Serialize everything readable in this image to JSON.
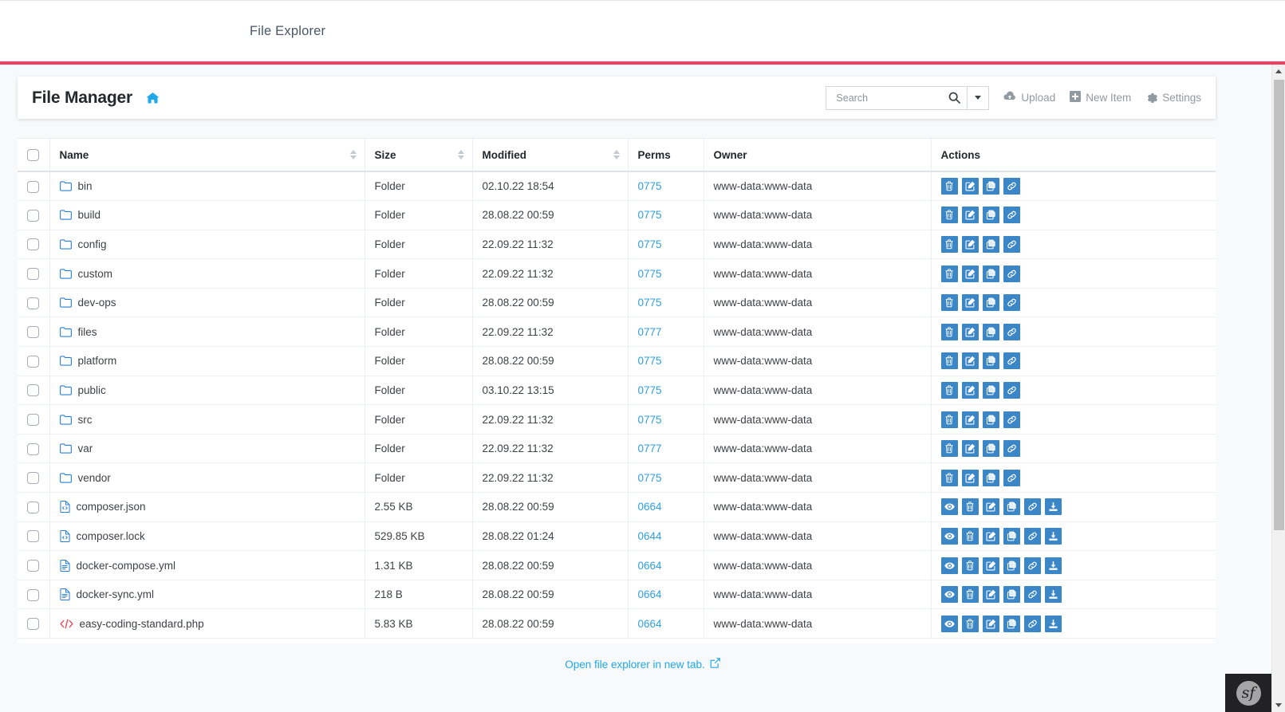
{
  "topbar": {
    "title": "File Explorer"
  },
  "card": {
    "title": "File Manager",
    "home_icon": "home-icon"
  },
  "search": {
    "placeholder": "Search",
    "value": "",
    "icon": "search-icon",
    "caret_icon": "chevron-down-icon"
  },
  "toolbar": {
    "upload_label": "Upload",
    "upload_icon": "cloud-upload-icon",
    "new_item_label": "New Item",
    "new_item_icon": "plus-square-icon",
    "settings_label": "Settings",
    "settings_icon": "gear-icon"
  },
  "table": {
    "columns": [
      {
        "label": "",
        "sortable": false
      },
      {
        "label": "Name",
        "sortable": true
      },
      {
        "label": "Size",
        "sortable": true
      },
      {
        "label": "Modified",
        "sortable": true
      },
      {
        "label": "Perms",
        "sortable": false
      },
      {
        "label": "Owner",
        "sortable": false
      },
      {
        "label": "Actions",
        "sortable": false
      }
    ],
    "rows": [
      {
        "name": "bin",
        "kind": "folder",
        "icon": "folder-icon",
        "size": "Folder",
        "modified": "02.10.22 18:54",
        "perms": "0775",
        "owner": "www-data:www-data",
        "actions": [
          "delete-icon",
          "edit-icon",
          "copy-icon",
          "link-icon"
        ]
      },
      {
        "name": "build",
        "kind": "folder",
        "icon": "folder-icon",
        "size": "Folder",
        "modified": "28.08.22 00:59",
        "perms": "0775",
        "owner": "www-data:www-data",
        "actions": [
          "delete-icon",
          "edit-icon",
          "copy-icon",
          "link-icon"
        ]
      },
      {
        "name": "config",
        "kind": "folder",
        "icon": "folder-icon",
        "size": "Folder",
        "modified": "22.09.22 11:32",
        "perms": "0775",
        "owner": "www-data:www-data",
        "actions": [
          "delete-icon",
          "edit-icon",
          "copy-icon",
          "link-icon"
        ]
      },
      {
        "name": "custom",
        "kind": "folder",
        "icon": "folder-icon",
        "size": "Folder",
        "modified": "22.09.22 11:32",
        "perms": "0775",
        "owner": "www-data:www-data",
        "actions": [
          "delete-icon",
          "edit-icon",
          "copy-icon",
          "link-icon"
        ]
      },
      {
        "name": "dev-ops",
        "kind": "folder",
        "icon": "folder-icon",
        "size": "Folder",
        "modified": "28.08.22 00:59",
        "perms": "0775",
        "owner": "www-data:www-data",
        "actions": [
          "delete-icon",
          "edit-icon",
          "copy-icon",
          "link-icon"
        ]
      },
      {
        "name": "files",
        "kind": "folder",
        "icon": "folder-icon",
        "size": "Folder",
        "modified": "22.09.22 11:32",
        "perms": "0777",
        "owner": "www-data:www-data",
        "actions": [
          "delete-icon",
          "edit-icon",
          "copy-icon",
          "link-icon"
        ]
      },
      {
        "name": "platform",
        "kind": "folder",
        "icon": "folder-icon",
        "size": "Folder",
        "modified": "28.08.22 00:59",
        "perms": "0775",
        "owner": "www-data:www-data",
        "actions": [
          "delete-icon",
          "edit-icon",
          "copy-icon",
          "link-icon"
        ]
      },
      {
        "name": "public",
        "kind": "folder",
        "icon": "folder-icon",
        "size": "Folder",
        "modified": "03.10.22 13:15",
        "perms": "0775",
        "owner": "www-data:www-data",
        "actions": [
          "delete-icon",
          "edit-icon",
          "copy-icon",
          "link-icon"
        ]
      },
      {
        "name": "src",
        "kind": "folder",
        "icon": "folder-icon",
        "size": "Folder",
        "modified": "22.09.22 11:32",
        "perms": "0775",
        "owner": "www-data:www-data",
        "actions": [
          "delete-icon",
          "edit-icon",
          "copy-icon",
          "link-icon"
        ]
      },
      {
        "name": "var",
        "kind": "folder",
        "icon": "folder-icon",
        "size": "Folder",
        "modified": "22.09.22 11:32",
        "perms": "0777",
        "owner": "www-data:www-data",
        "actions": [
          "delete-icon",
          "edit-icon",
          "copy-icon",
          "link-icon"
        ]
      },
      {
        "name": "vendor",
        "kind": "folder",
        "icon": "folder-icon",
        "size": "Folder",
        "modified": "22.09.22 11:32",
        "perms": "0775",
        "owner": "www-data:www-data",
        "actions": [
          "delete-icon",
          "edit-icon",
          "copy-icon",
          "link-icon"
        ]
      },
      {
        "name": "composer.json",
        "kind": "file-code-blue",
        "icon": "file-code-icon",
        "size": "2.55 KB",
        "modified": "28.08.22 00:59",
        "perms": "0664",
        "owner": "www-data:www-data",
        "actions": [
          "view-icon",
          "delete-icon",
          "edit-icon",
          "copy-icon",
          "link-icon",
          "download-icon"
        ]
      },
      {
        "name": "composer.lock",
        "kind": "file-code-blue",
        "icon": "file-code-icon",
        "size": "529.85 KB",
        "modified": "28.08.22 01:24",
        "perms": "0644",
        "owner": "www-data:www-data",
        "actions": [
          "view-icon",
          "delete-icon",
          "edit-icon",
          "copy-icon",
          "link-icon",
          "download-icon"
        ]
      },
      {
        "name": "docker-compose.yml",
        "kind": "file-text-blue",
        "icon": "file-text-icon",
        "size": "1.31 KB",
        "modified": "28.08.22 00:59",
        "perms": "0664",
        "owner": "www-data:www-data",
        "actions": [
          "view-icon",
          "delete-icon",
          "edit-icon",
          "copy-icon",
          "link-icon",
          "download-icon"
        ]
      },
      {
        "name": "docker-sync.yml",
        "kind": "file-text-blue",
        "icon": "file-text-icon",
        "size": "218 B",
        "modified": "28.08.22 00:59",
        "perms": "0664",
        "owner": "www-data:www-data",
        "actions": [
          "view-icon",
          "delete-icon",
          "edit-icon",
          "copy-icon",
          "link-icon",
          "download-icon"
        ]
      },
      {
        "name": "easy-coding-standard.php",
        "kind": "code-red",
        "icon": "code-brackets-icon",
        "size": "5.83 KB",
        "modified": "28.08.22 00:59",
        "perms": "0664",
        "owner": "www-data:www-data",
        "actions": [
          "view-icon",
          "delete-icon",
          "edit-icon",
          "copy-icon",
          "link-icon",
          "download-icon"
        ]
      }
    ]
  },
  "footer": {
    "link_label": "Open file explorer in new tab.",
    "link_icon": "external-link-icon"
  },
  "status_bar": {
    "profiler_badge": "sf"
  },
  "colors": {
    "accent_red": "#f23d5e",
    "action_blue": "#3b86c7",
    "link_blue": "#20a8e8",
    "perm_blue": "#2f9fe0"
  }
}
